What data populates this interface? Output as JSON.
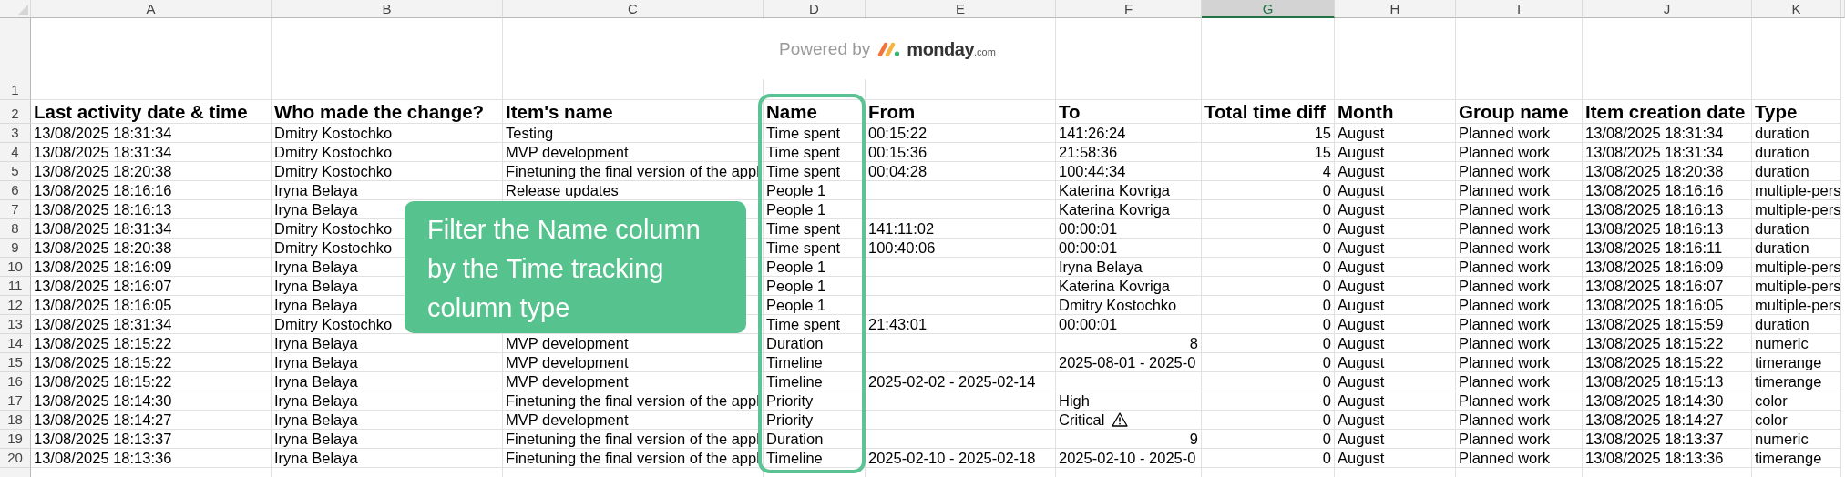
{
  "column_headers": [
    {
      "label": "A",
      "selected": false
    },
    {
      "label": "B",
      "selected": false
    },
    {
      "label": "C",
      "selected": false
    },
    {
      "label": "D",
      "selected": false
    },
    {
      "label": "E",
      "selected": false
    },
    {
      "label": "F",
      "selected": false
    },
    {
      "label": "G",
      "selected": true
    },
    {
      "label": "H",
      "selected": false
    },
    {
      "label": "I",
      "selected": false
    },
    {
      "label": "J",
      "selected": false
    },
    {
      "label": "K",
      "selected": false
    }
  ],
  "logo": {
    "prefix": "Powered by",
    "brand": "monday",
    "domain": ".com"
  },
  "table": {
    "title_row_number": "1",
    "header_row_number": "2",
    "columns": [
      {
        "label": "Last activity date & time",
        "highlighted": false
      },
      {
        "label": "Who made the change?",
        "highlighted": false
      },
      {
        "label": "Item's name",
        "highlighted": false
      },
      {
        "label": "Name",
        "highlighted": true
      },
      {
        "label": "From",
        "highlighted": false
      },
      {
        "label": "To",
        "highlighted": false
      },
      {
        "label": "Total time diff",
        "highlighted": false
      },
      {
        "label": "Month",
        "highlighted": false
      },
      {
        "label": "Group name",
        "highlighted": false
      },
      {
        "label": "Item creation date",
        "highlighted": false
      },
      {
        "label": "Type",
        "highlighted": false
      }
    ],
    "rows": [
      {
        "number": "3",
        "cells": [
          "13/08/2025 18:31:34",
          "Dmitry Kostochko",
          "Testing",
          "Time spent",
          "00:15:22",
          "141:26:24",
          {
            "text": "15",
            "kind": "number"
          },
          "August",
          "Planned work",
          "13/08/2025 18:31:34",
          "duration"
        ]
      },
      {
        "number": "4",
        "cells": [
          "13/08/2025 18:31:34",
          "Dmitry Kostochko",
          "MVP development",
          "Time spent",
          "00:15:36",
          "21:58:36",
          {
            "text": "15",
            "kind": "number"
          },
          "August",
          "Planned work",
          "13/08/2025 18:31:34",
          "duration"
        ]
      },
      {
        "number": "5",
        "cells": [
          "13/08/2025 18:20:38",
          "Dmitry Kostochko",
          "Finetuning the final version of the appl",
          "Time spent",
          "00:04:28",
          "100:44:34",
          {
            "text": "4",
            "kind": "number"
          },
          "August",
          "Planned work",
          "13/08/2025 18:20:38",
          "duration"
        ]
      },
      {
        "number": "6",
        "cells": [
          "13/08/2025 18:16:16",
          "Iryna Belaya",
          "Release updates",
          "People 1",
          null,
          "Katerina Kovriga",
          {
            "text": "0",
            "kind": "number"
          },
          "August",
          "Planned work",
          "13/08/2025 18:16:16",
          "multiple-pers"
        ]
      },
      {
        "number": "7",
        "cells": [
          "13/08/2025 18:16:13",
          "Iryna Belaya",
          null,
          "People 1",
          null,
          "Katerina Kovriga",
          {
            "text": "0",
            "kind": "number"
          },
          "August",
          "Planned work",
          "13/08/2025 18:16:13",
          "multiple-pers"
        ]
      },
      {
        "number": "8",
        "cells": [
          "13/08/2025 18:31:34",
          "Dmitry Kostochko",
          null,
          "Time spent",
          "141:11:02",
          "00:00:01",
          {
            "text": "0",
            "kind": "number"
          },
          "August",
          "Planned work",
          "13/08/2025 18:16:13",
          "duration"
        ]
      },
      {
        "number": "9",
        "cells": [
          "13/08/2025 18:20:38",
          "Dmitry Kostochko",
          null,
          "Time spent",
          "100:40:06",
          "00:00:01",
          {
            "text": "0",
            "kind": "number"
          },
          "August",
          "Planned work",
          "13/08/2025 18:16:11",
          "duration"
        ]
      },
      {
        "number": "10",
        "cells": [
          "13/08/2025 18:16:09",
          "Iryna Belaya",
          null,
          "People 1",
          null,
          "Iryna Belaya",
          {
            "text": "0",
            "kind": "number"
          },
          "August",
          "Planned work",
          "13/08/2025 18:16:09",
          "multiple-pers"
        ]
      },
      {
        "number": "11",
        "cells": [
          "13/08/2025 18:16:07",
          "Iryna Belaya",
          null,
          "People 1",
          null,
          "Katerina Kovriga",
          {
            "text": "0",
            "kind": "number"
          },
          "August",
          "Planned work",
          "13/08/2025 18:16:07",
          "multiple-pers"
        ]
      },
      {
        "number": "12",
        "cells": [
          "13/08/2025 18:16:05",
          "Iryna Belaya",
          null,
          "People 1",
          null,
          "Dmitry Kostochko",
          {
            "text": "0",
            "kind": "number"
          },
          "August",
          "Planned work",
          "13/08/2025 18:16:05",
          "multiple-pers"
        ]
      },
      {
        "number": "13",
        "cells": [
          "13/08/2025 18:31:34",
          "Dmitry Kostochko",
          null,
          "Time spent",
          "21:43:01",
          "00:00:01",
          {
            "text": "0",
            "kind": "number"
          },
          "August",
          "Planned work",
          "13/08/2025 18:15:59",
          "duration"
        ]
      },
      {
        "number": "14",
        "cells": [
          "13/08/2025 18:15:22",
          "Iryna Belaya",
          "MVP development",
          "Duration",
          null,
          {
            "text": "8",
            "kind": "number"
          },
          {
            "text": "0",
            "kind": "number"
          },
          "August",
          "Planned work",
          "13/08/2025 18:15:22",
          "numeric"
        ]
      },
      {
        "number": "15",
        "cells": [
          "13/08/2025 18:15:22",
          "Iryna Belaya",
          "MVP development",
          "Timeline",
          null,
          "2025-08-01 - 2025-0",
          {
            "text": "0",
            "kind": "number"
          },
          "August",
          "Planned work",
          "13/08/2025 18:15:22",
          "timerange"
        ]
      },
      {
        "number": "16",
        "cells": [
          "13/08/2025 18:15:22",
          "Iryna Belaya",
          "MVP development",
          "Timeline",
          "2025-02-02 - 2025-02-14",
          null,
          {
            "text": "0",
            "kind": "number"
          },
          "August",
          "Planned work",
          "13/08/2025 18:15:13",
          "timerange"
        ]
      },
      {
        "number": "17",
        "cells": [
          "13/08/2025 18:14:30",
          "Iryna Belaya",
          "Finetuning the final version of the appl",
          "Priority",
          null,
          "High",
          {
            "text": "0",
            "kind": "number"
          },
          "August",
          "Planned work",
          "13/08/2025 18:14:30",
          "color"
        ]
      },
      {
        "number": "18",
        "cells": [
          "13/08/2025 18:14:27",
          "Iryna Belaya",
          "MVP development",
          "Priority",
          null,
          {
            "text": "Critical",
            "kind": "warning"
          },
          {
            "text": "0",
            "kind": "number"
          },
          "August",
          "Planned work",
          "13/08/2025 18:14:27",
          "color"
        ]
      },
      {
        "number": "19",
        "cells": [
          "13/08/2025 18:13:37",
          "Iryna Belaya",
          "Finetuning the final version of the appl",
          "Duration",
          null,
          {
            "text": "9",
            "kind": "number"
          },
          {
            "text": "0",
            "kind": "number"
          },
          "August",
          "Planned work",
          "13/08/2025 18:13:37",
          "numeric"
        ]
      },
      {
        "number": "20",
        "cells": [
          "13/08/2025 18:13:36",
          "Iryna Belaya",
          "Finetuning the final version of the appl",
          "Timeline",
          "2025-02-10 - 2025-02-18",
          "2025-02-10 - 2025-0",
          {
            "text": "0",
            "kind": "number"
          },
          "August",
          "Planned work",
          "13/08/2025 18:13:36",
          "timerange"
        ]
      }
    ]
  },
  "callout": {
    "lines": [
      "Filter the Name column",
      "by the Time tracking",
      "column type"
    ]
  }
}
